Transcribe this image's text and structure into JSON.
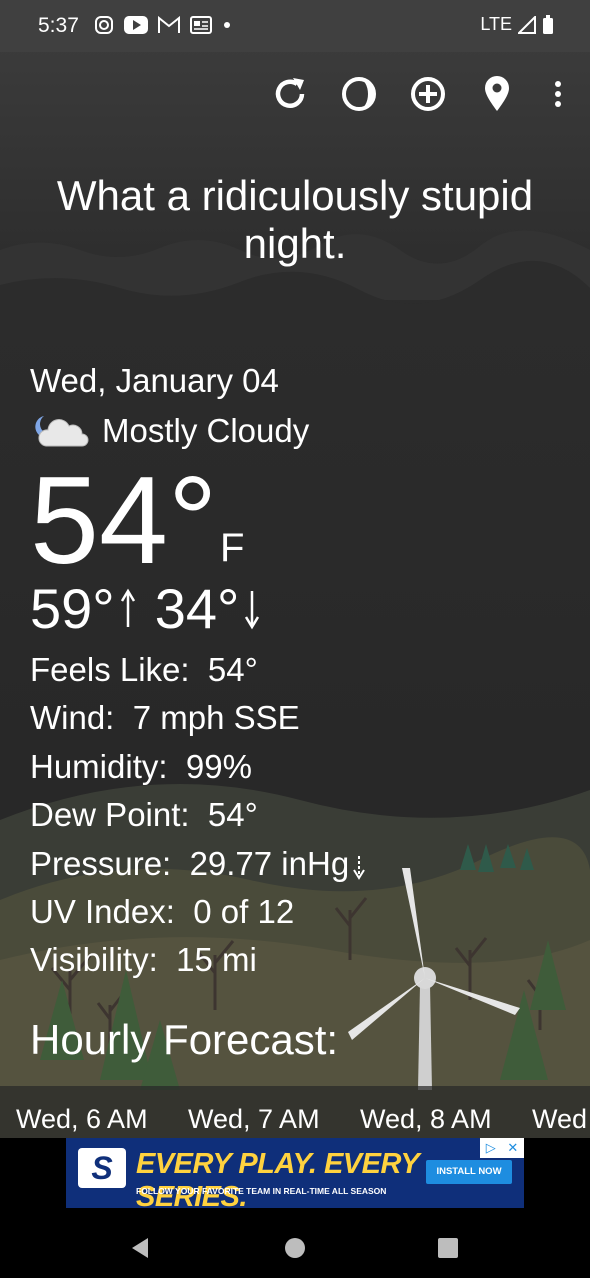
{
  "status_bar": {
    "time": "5:37",
    "network": "LTE",
    "notification_icons": [
      "instagram-icon",
      "youtube-icon",
      "gmail-icon",
      "news-icon",
      "dot-icon"
    ]
  },
  "toolbar": {
    "icons": [
      "refresh-icon",
      "theme-icon",
      "add-location-icon",
      "location-pin-icon",
      "more-vert-icon"
    ]
  },
  "headline": "What a ridiculously stupid night.",
  "weather": {
    "date": "Wed, January 04",
    "condition": "Mostly Cloudy",
    "condition_icon": "partly-cloudy-night-icon",
    "temperature": "54°",
    "unit": "F",
    "high": "59°",
    "low": "34°"
  },
  "details": [
    {
      "label": "Feels Like:",
      "value": "54°"
    },
    {
      "label": "Wind:",
      "value": "7 mph SSE"
    },
    {
      "label": "Humidity:",
      "value": "99%"
    },
    {
      "label": "Dew Point:",
      "value": "54°"
    },
    {
      "label": "Pressure:",
      "value": "29.77 inHg",
      "trend": "falling"
    },
    {
      "label": "UV Index:",
      "value": "0 of 12"
    },
    {
      "label": "Visibility:",
      "value": "15 mi"
    }
  ],
  "hourly": {
    "title": "Hourly Forecast:",
    "items": [
      "Wed, 6 AM",
      "Wed, 7 AM",
      "Wed, 8 AM",
      "Wed"
    ]
  },
  "ad": {
    "logo": "S",
    "headline": "EVERY PLAY. EVERY SERIES.",
    "subtext": "FOLLOW YOUR FAVORITE TEAM IN REAL-TIME ALL SEASON",
    "cta": "INSTALL NOW",
    "close": "✕",
    "adchoices": "▷"
  },
  "nav": {
    "icons": [
      "back-icon",
      "home-icon",
      "recents-icon"
    ]
  },
  "colors": {
    "sky": "#262626",
    "status_bar": "#404040",
    "ad_blue": "#0f2f7a",
    "ad_yellow": "#ffd23f"
  }
}
